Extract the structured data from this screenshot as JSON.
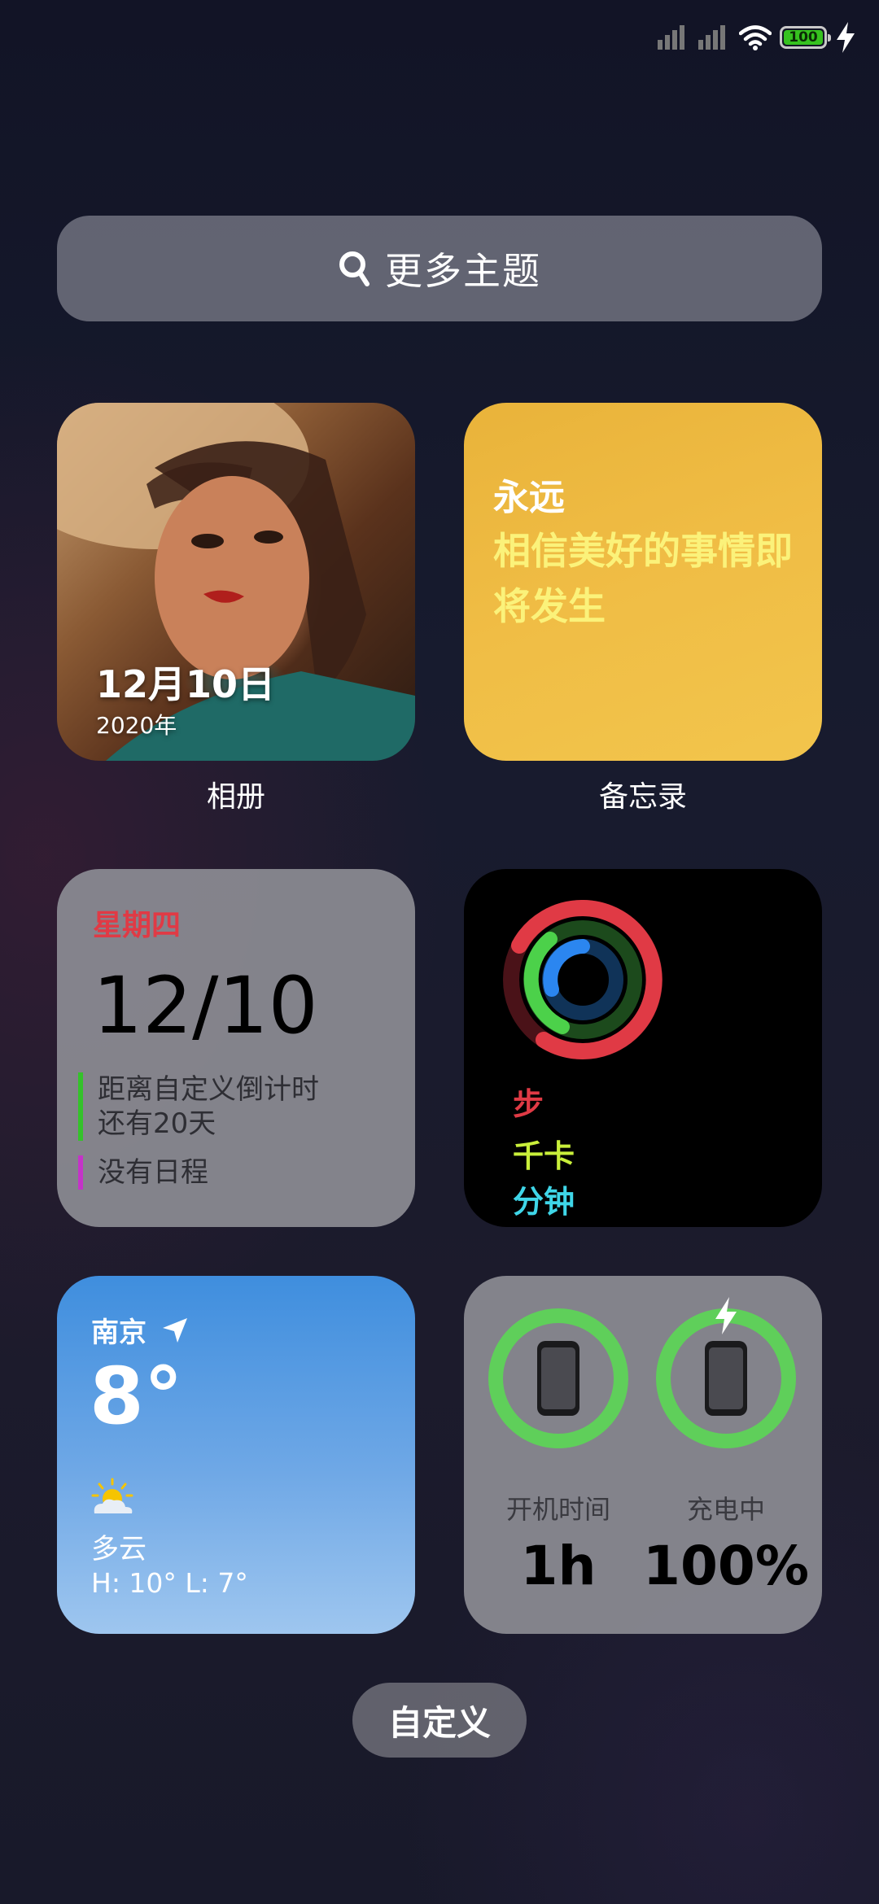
{
  "status_bar": {
    "battery_level": "100"
  },
  "search": {
    "label": "更多主题"
  },
  "widgets": {
    "photo": {
      "date": "12月10日",
      "year": "2020年",
      "caption": "相册"
    },
    "notes": {
      "title": "永远",
      "body": "相信美好的事情即将发生",
      "caption": "备忘录"
    },
    "calendar": {
      "weekday": "星期四",
      "date": "12/10",
      "events": [
        {
          "text": "距离自定义倒计时\n还有20天",
          "color": "#34c22a"
        },
        {
          "text": "没有日程",
          "color": "#c433c8"
        }
      ]
    },
    "fitness": {
      "labels": {
        "steps": "步",
        "kcal": "千卡",
        "minutes": "分钟"
      },
      "colors": {
        "steps": "#e03a45",
        "kcal": "#c9ef3a",
        "minutes": "#3fd6e8"
      }
    },
    "weather": {
      "city": "南京",
      "temperature": "8°",
      "condition": "多云",
      "high_low": "H: 10° L: 7°",
      "icon": "partly-cloudy-icon"
    },
    "battery": {
      "uptime_label": "开机时间",
      "uptime_value": "1h",
      "charging_label": "充电中",
      "charging_value": "100%",
      "ring_color": "#5fcf5a"
    }
  },
  "customize_button": {
    "label": "自定义"
  }
}
